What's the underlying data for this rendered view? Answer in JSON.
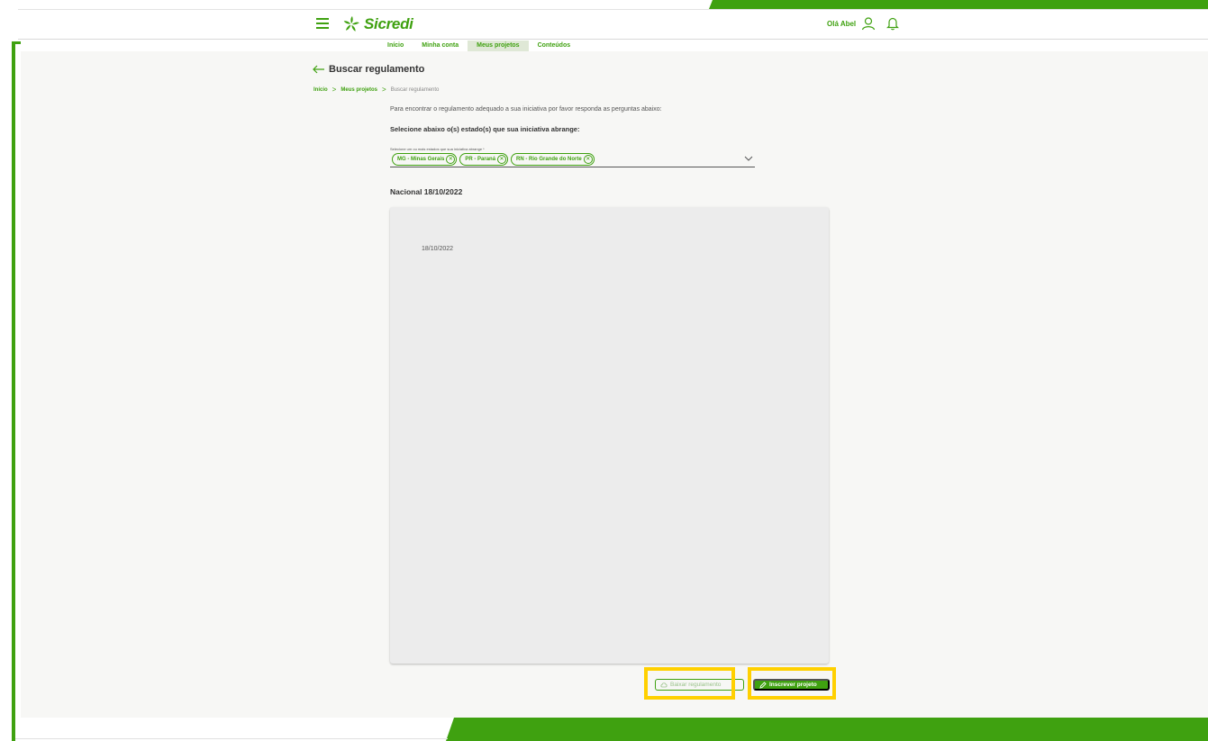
{
  "brand": {
    "name": "Sicredi",
    "color": "#3fa110"
  },
  "header": {
    "greeting": "Olá Abel",
    "icons": {
      "menu": "hamburger-menu-icon",
      "logo": "sicredi-logo-icon",
      "user": "user-icon",
      "notifications": "bell-icon"
    }
  },
  "nav": {
    "items": [
      {
        "label": "Início",
        "active": false
      },
      {
        "label": "Minha conta",
        "active": false
      },
      {
        "label": "Meus projetos",
        "active": true
      },
      {
        "label": "Conteúdos",
        "active": false
      }
    ]
  },
  "page": {
    "title": "Buscar regulamento",
    "breadcrumb": [
      "Início",
      "Meus projetos",
      "Buscar regulamento"
    ]
  },
  "form": {
    "intro": "Para encontrar o regulamento adequado a sua iniciativa por favor responda as perguntas abaixo:",
    "question": "Selecione abaixo o(s) estado(s) que sua iniciativa abrange:",
    "select_label": "Selecione um ou mais estados que sua iniciativa abrange *",
    "selected_states": [
      "MG - Minas Gerais",
      "PR - Paraná",
      "RN - Rio Grande do Norte"
    ]
  },
  "regulation": {
    "heading": "Nacional 18/10/2022",
    "document_date": "18/10/2022"
  },
  "actions": {
    "download_label": "Baixar regulamento",
    "subscribe_label": "Inscrever projeto"
  },
  "colors": {
    "accent": "#3fa110",
    "highlight": "#ffd000",
    "background": "#f7f7f5",
    "card": "#ececec"
  }
}
